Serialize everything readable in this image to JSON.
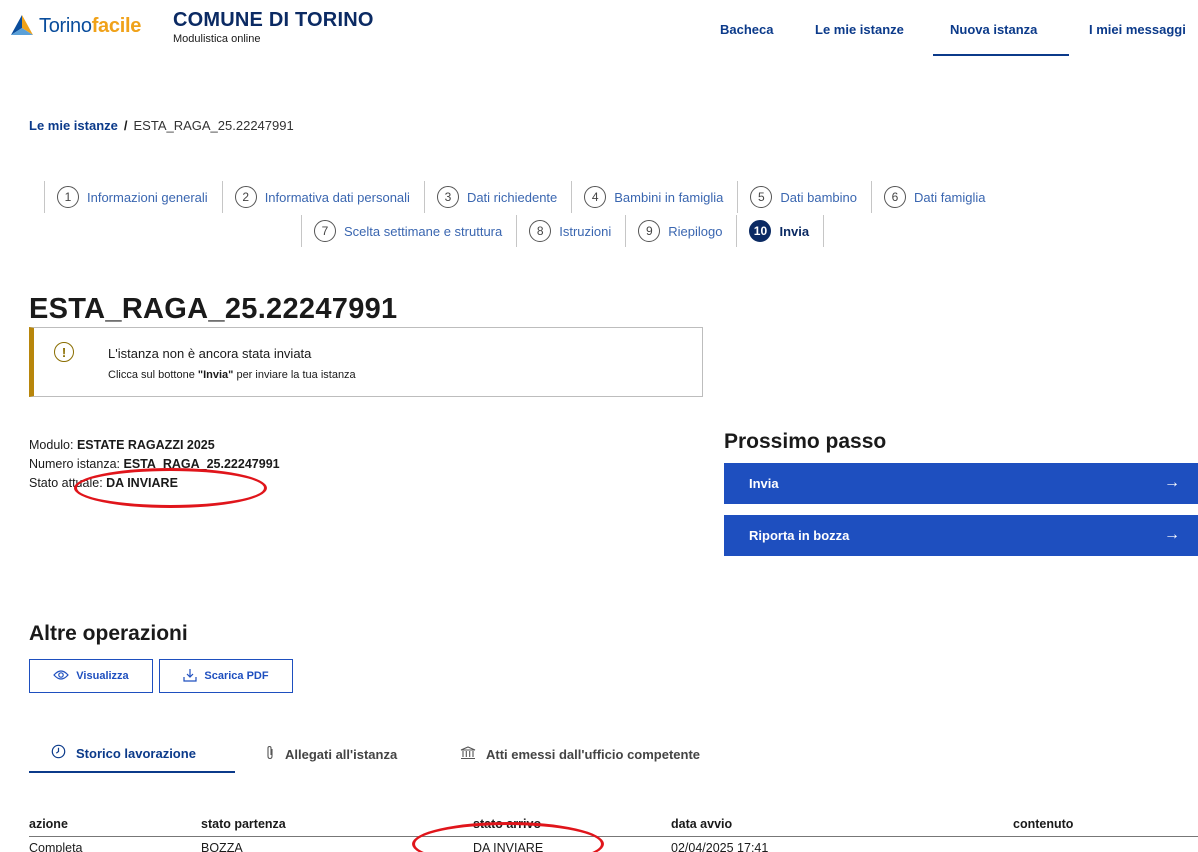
{
  "brand": {
    "logo_part1": "Torino",
    "logo_part2": "facile",
    "comune_title": "COMUNE DI TORINO",
    "comune_subtitle": "Modulistica online"
  },
  "nav": [
    {
      "label": "Bacheca"
    },
    {
      "label": "Le mie istanze"
    },
    {
      "label": "Nuova istanza",
      "active": true
    },
    {
      "label": "I miei messaggi"
    }
  ],
  "breadcrumb": {
    "link": "Le mie istanze",
    "separator": "/",
    "current": "ESTA_RAGA_25.22247991"
  },
  "steps": [
    {
      "num": "1",
      "label": "Informazioni generali"
    },
    {
      "num": "2",
      "label": "Informativa dati personali"
    },
    {
      "num": "3",
      "label": "Dati richiedente"
    },
    {
      "num": "4",
      "label": "Bambini in famiglia"
    },
    {
      "num": "5",
      "label": "Dati bambino"
    },
    {
      "num": "6",
      "label": "Dati famiglia"
    },
    {
      "num": "7",
      "label": "Scelta settimane e struttura"
    },
    {
      "num": "8",
      "label": "Istruzioni"
    },
    {
      "num": "9",
      "label": "Riepilogo"
    },
    {
      "num": "10",
      "label": "Invia",
      "current": true
    }
  ],
  "title": "ESTA_RAGA_25.22247991",
  "alert": {
    "icon": "!",
    "line1": "L'istanza non è ancora stata inviata",
    "line2_pre": "Clicca sul bottone ",
    "line2_bold": "\"Invia\"",
    "line2_post": " per inviare la tua istanza"
  },
  "info": {
    "modulo_label": "Modulo: ",
    "modulo_value": "ESTATE RAGAZZI 2025",
    "numero_label": "Numero istanza: ",
    "numero_value": "ESTA_RAGA_25.22247991",
    "stato_label": "Stato attuale: ",
    "stato_value": "DA INVIARE"
  },
  "next_step": {
    "title": "Prossimo passo",
    "buttons": [
      {
        "label": "Invia",
        "arrow": "→"
      },
      {
        "label": "Riporta in bozza",
        "arrow": "→"
      }
    ]
  },
  "altre_operazioni": {
    "title": "Altre operazioni",
    "visualizza": "Visualizza",
    "scarica_pdf": "Scarica PDF"
  },
  "tabs": [
    {
      "label": "Storico lavorazione",
      "icon": "clock-icon",
      "active": true
    },
    {
      "label": "Allegati all'istanza",
      "icon": "paperclip-icon"
    },
    {
      "label": "Atti emessi dall'ufficio competente",
      "icon": "institution-icon"
    }
  ],
  "history_table": {
    "columns": [
      "azione",
      "stato partenza",
      "stato arrivo",
      "data avvio",
      "contenuto"
    ],
    "rows": [
      [
        "Completa",
        "BOZZA",
        "DA INVIARE",
        "02/04/2025 17:41",
        ""
      ]
    ]
  },
  "colors": {
    "primary_dark": "#0b2a63",
    "primary_blue": "#1e4fbf",
    "link_blue": "#0b3a8a",
    "brand_orange": "#f0a21a",
    "alert_border": "#b8860b",
    "highlight_red": "#e0151b"
  }
}
